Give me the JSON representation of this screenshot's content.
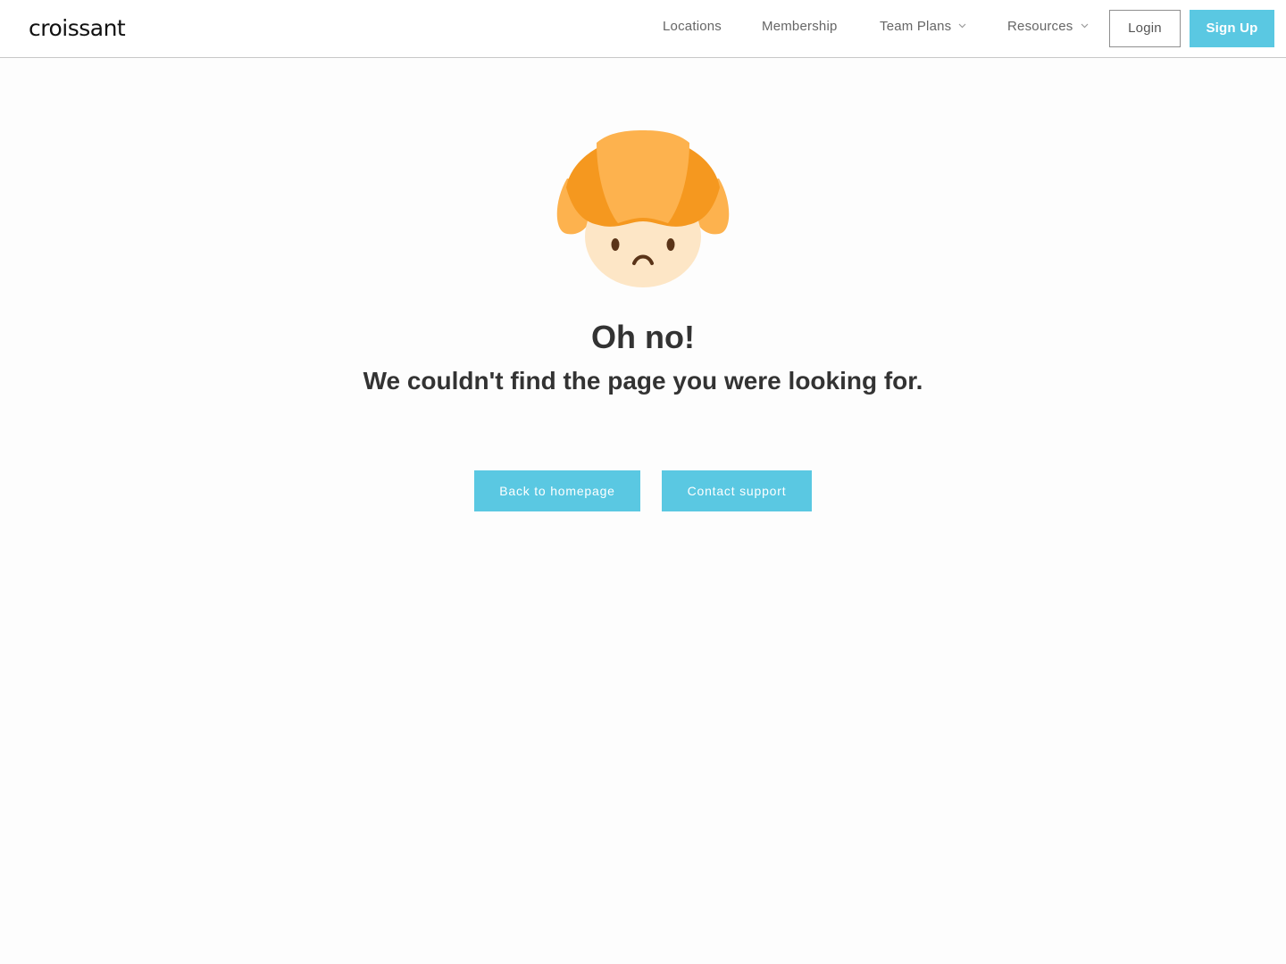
{
  "brand": {
    "logo_text": "croissant"
  },
  "nav": {
    "locations": "Locations",
    "membership": "Membership",
    "team_plans": "Team Plans",
    "resources": "Resources",
    "login": "Login",
    "signup": "Sign Up"
  },
  "error": {
    "title": "Oh no!",
    "message": "We couldn't find the page you were looking for."
  },
  "actions": {
    "back_home": "Back to homepage",
    "contact_support": "Contact support"
  },
  "colors": {
    "accent": "#5ac8e2",
    "croissant_dark": "#f5981f",
    "croissant_light": "#fdb24e",
    "face": "#fde6c6",
    "heading_text": "#333333"
  },
  "icons": {
    "team_plans_dropdown": "chevron-down-icon",
    "resources_dropdown": "chevron-down-icon",
    "mascot": "sad-croissant-icon"
  }
}
